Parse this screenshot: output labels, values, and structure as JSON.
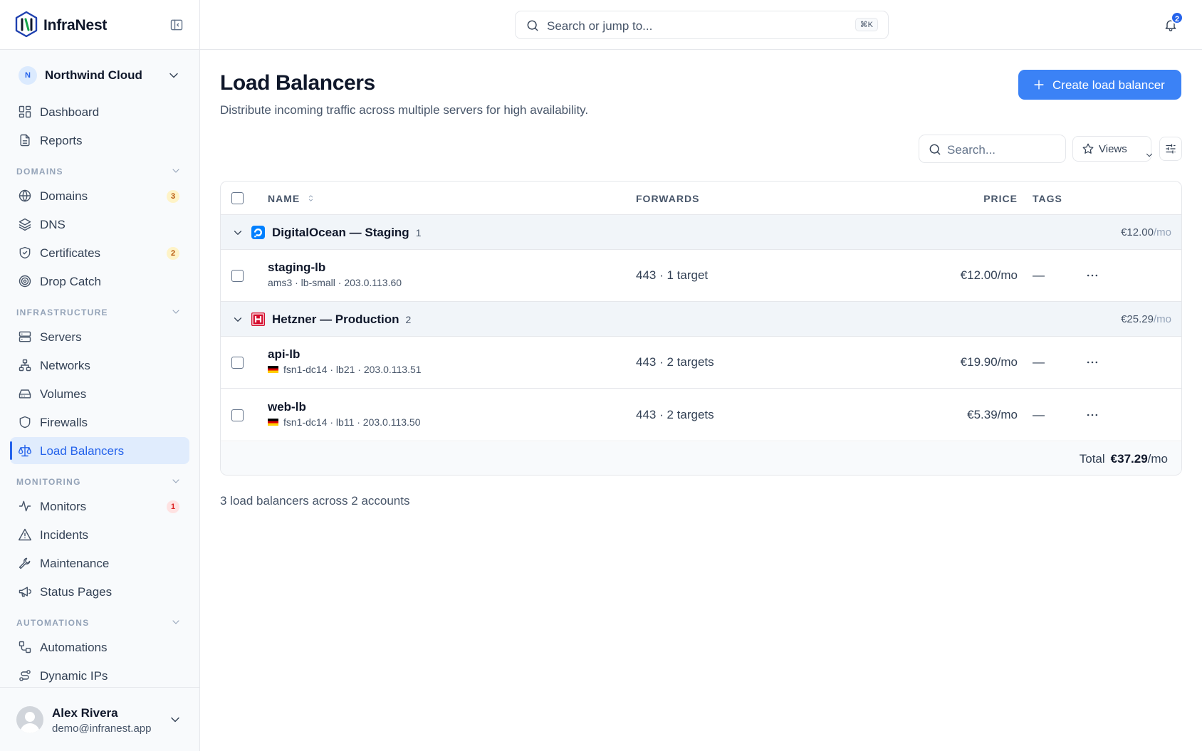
{
  "app": {
    "name": "InfraNest"
  },
  "org": {
    "initial": "N",
    "name": "Northwind Cloud"
  },
  "sidebar": {
    "top": [
      {
        "label": "Dashboard"
      },
      {
        "label": "Reports"
      }
    ],
    "sections": [
      {
        "title": "DOMAINS",
        "items": [
          {
            "label": "Domains",
            "badge": "3"
          },
          {
            "label": "DNS"
          },
          {
            "label": "Certificates",
            "badge": "2"
          },
          {
            "label": "Drop Catch"
          }
        ]
      },
      {
        "title": "INFRASTRUCTURE",
        "items": [
          {
            "label": "Servers"
          },
          {
            "label": "Networks"
          },
          {
            "label": "Volumes"
          },
          {
            "label": "Firewalls"
          },
          {
            "label": "Load Balancers"
          }
        ]
      },
      {
        "title": "MONITORING",
        "items": [
          {
            "label": "Monitors",
            "badge": "1"
          },
          {
            "label": "Incidents"
          },
          {
            "label": "Maintenance"
          },
          {
            "label": "Status Pages"
          }
        ]
      },
      {
        "title": "AUTOMATIONS",
        "items": [
          {
            "label": "Automations"
          },
          {
            "label": "Dynamic IPs"
          }
        ]
      }
    ]
  },
  "user": {
    "name": "Alex Rivera",
    "email": "demo@infranest.app"
  },
  "topbar": {
    "search_placeholder": "Search or jump to...",
    "shortcut": "⌘K",
    "notifications": "2"
  },
  "page": {
    "title": "Load Balancers",
    "description": "Distribute incoming traffic across multiple servers for high availability.",
    "create_label": "Create load balancer",
    "search_placeholder": "Search...",
    "views_label": "Views",
    "summary": "3 load balancers across 2 accounts"
  },
  "table": {
    "headers": {
      "name": "NAME",
      "forwards": "FORWARDS",
      "price": "PRICE",
      "tags": "TAGS"
    },
    "groups": [
      {
        "name": "DigitalOcean — Staging",
        "count": "1",
        "total": "€12.00",
        "total_unit": "/mo",
        "rows": [
          {
            "name": "staging-lb",
            "meta": "ams3 · lb-small · 203.0.113.60",
            "forwards": "443 · 1 target",
            "price": "€12.00/mo",
            "tags": "—"
          }
        ]
      },
      {
        "name": "Hetzner — Production",
        "count": "2",
        "total": "€25.29",
        "total_unit": "/mo",
        "rows": [
          {
            "name": "api-lb",
            "meta": "fsn1-dc14 · lb21 · 203.0.113.51",
            "forwards": "443 · 2 targets",
            "price": "€19.90/mo",
            "tags": "—"
          },
          {
            "name": "web-lb",
            "meta": "fsn1-dc14 · lb11 · 203.0.113.50",
            "forwards": "443 · 2 targets",
            "price": "€5.39/mo",
            "tags": "—"
          }
        ]
      }
    ],
    "total_label": "Total",
    "total_value": "€37.29",
    "total_unit": "/mo"
  },
  "colors": {
    "accent": "#3b82f6",
    "digitalocean": "#0080ff",
    "hetzner": "#d50c2d"
  }
}
